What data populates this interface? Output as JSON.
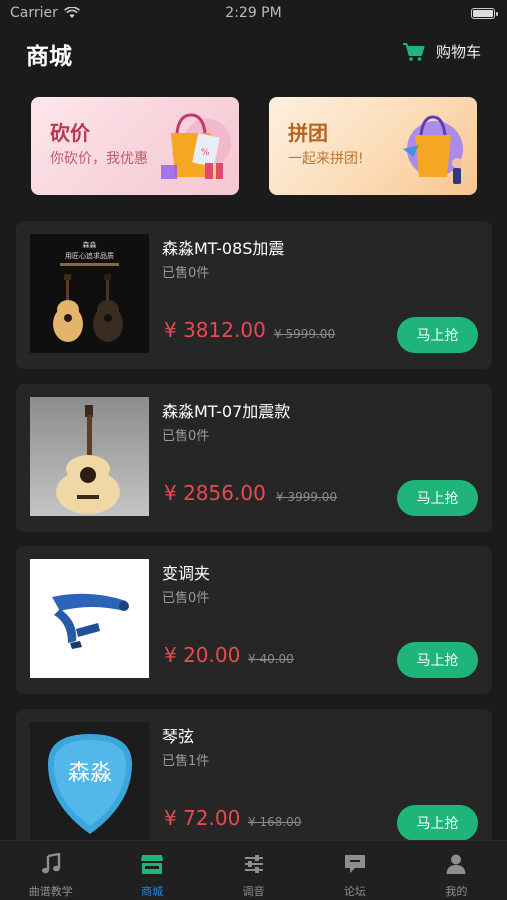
{
  "status_bar": {
    "carrier": "Carrier",
    "time": "2:29 PM"
  },
  "header": {
    "title": "商城",
    "cart_label": "购物车"
  },
  "promos": [
    {
      "title": "砍价",
      "subtitle": "你砍价，我优惠",
      "icon": "shopping-bag-illustration"
    },
    {
      "title": "拼团",
      "subtitle": "一起来拼团!",
      "icon": "shopping-bag-illustration"
    }
  ],
  "products": [
    {
      "name": "森淼MT-08S加震",
      "sold": "已售0件",
      "price": "¥ 3812.00",
      "original_price": "¥ 5999.00",
      "buy_label": "马上抢",
      "image_text": [
        "森淼",
        "用匠心追求品质"
      ]
    },
    {
      "name": "森淼MT-07加震款",
      "sold": "已售0件",
      "price": "¥ 2856.00",
      "original_price": "¥ 3999.00",
      "buy_label": "马上抢"
    },
    {
      "name": "变调夹",
      "sold": "已售0件",
      "price": "¥ 20.00",
      "original_price": "¥ 40.00",
      "buy_label": "马上抢"
    },
    {
      "name": "琴弦",
      "sold": "已售1件",
      "price": "¥ 72.00",
      "original_price": "¥ 168.00",
      "buy_label": "马上抢",
      "image_text": [
        "森淼"
      ]
    }
  ],
  "tabs": [
    {
      "label": "曲谱教学",
      "icon": "music-note-icon",
      "active": false
    },
    {
      "label": "商城",
      "icon": "store-icon",
      "active": true
    },
    {
      "label": "调音",
      "icon": "sliders-icon",
      "active": false
    },
    {
      "label": "论坛",
      "icon": "chat-icon",
      "active": false
    },
    {
      "label": "我的",
      "icon": "person-icon",
      "active": false
    }
  ],
  "colors": {
    "accent": "#1fb57a",
    "price": "#e84a4f",
    "active_tab": "#1e88e5",
    "background": "#1b1b1b"
  }
}
